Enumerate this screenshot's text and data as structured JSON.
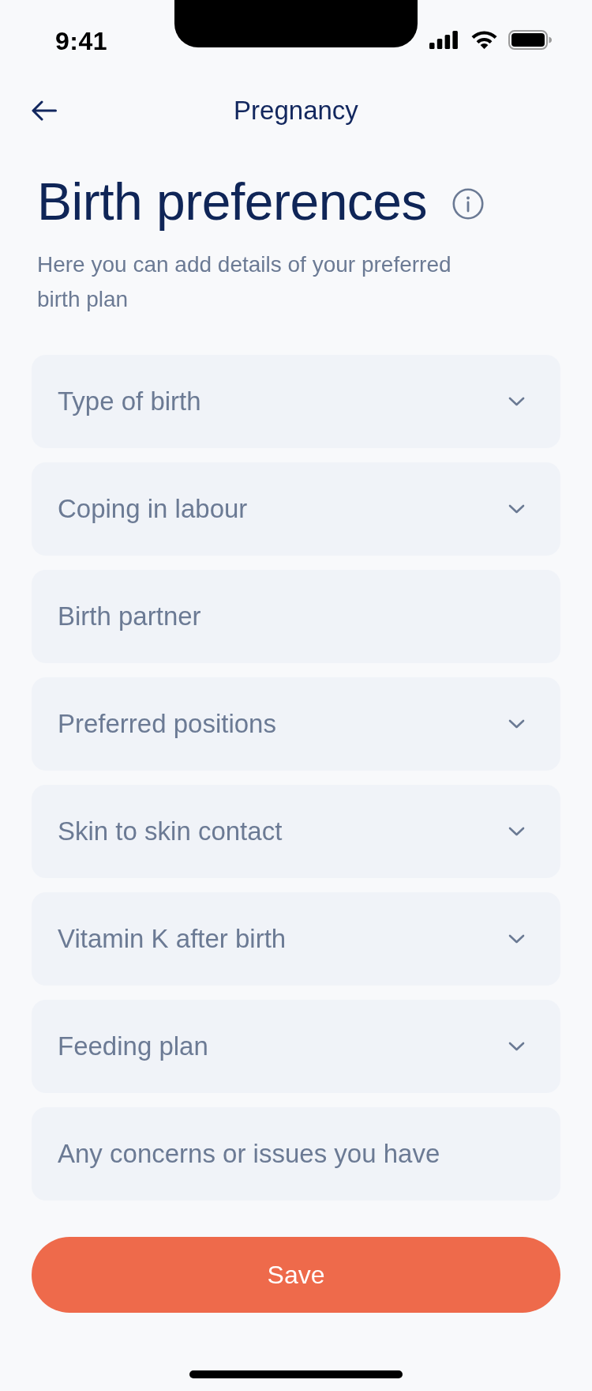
{
  "status_bar": {
    "time": "9:41"
  },
  "header": {
    "title": "Pregnancy"
  },
  "page": {
    "title": "Birth preferences",
    "subtitle": "Here you can add details of your preferred birth plan"
  },
  "fields": [
    {
      "kind": "select",
      "placeholder": "Type of birth"
    },
    {
      "kind": "select",
      "placeholder": "Coping in labour"
    },
    {
      "kind": "text",
      "placeholder": "Birth partner"
    },
    {
      "kind": "select",
      "placeholder": "Preferred positions"
    },
    {
      "kind": "select",
      "placeholder": "Skin to skin contact"
    },
    {
      "kind": "select",
      "placeholder": "Vitamin K after birth"
    },
    {
      "kind": "select",
      "placeholder": "Feeding plan"
    },
    {
      "kind": "text",
      "placeholder": "Any concerns or issues you have"
    }
  ],
  "save_button": {
    "label": "Save"
  }
}
